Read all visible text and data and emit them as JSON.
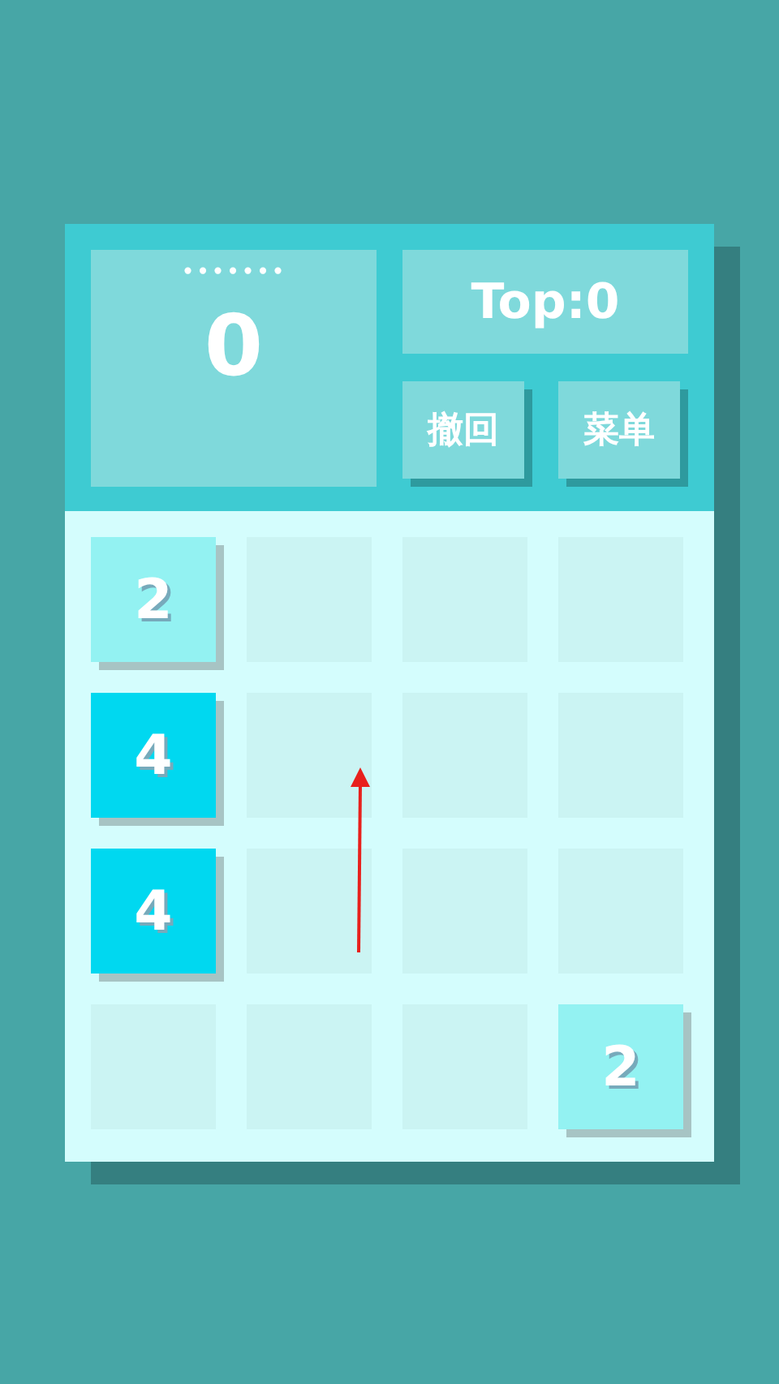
{
  "score": {
    "dots": "•••••••",
    "value": "0"
  },
  "best": "Top:0",
  "buttons": [
    "撤回",
    "菜单"
  ],
  "board": [
    {
      "kind": "tile",
      "value": "2",
      "color": "#93f2f2"
    },
    {
      "kind": "empty"
    },
    {
      "kind": "empty"
    },
    {
      "kind": "empty"
    },
    {
      "kind": "tile",
      "value": "4",
      "color": "#00d8f0"
    },
    {
      "kind": "empty"
    },
    {
      "kind": "empty"
    },
    {
      "kind": "empty"
    },
    {
      "kind": "tile",
      "value": "4",
      "color": "#00d8f0"
    },
    {
      "kind": "empty"
    },
    {
      "kind": "empty"
    },
    {
      "kind": "empty"
    },
    {
      "kind": "empty"
    },
    {
      "kind": "empty"
    },
    {
      "kind": "empty"
    },
    {
      "kind": "tile",
      "value": "2",
      "color": "#93f2f2"
    }
  ]
}
